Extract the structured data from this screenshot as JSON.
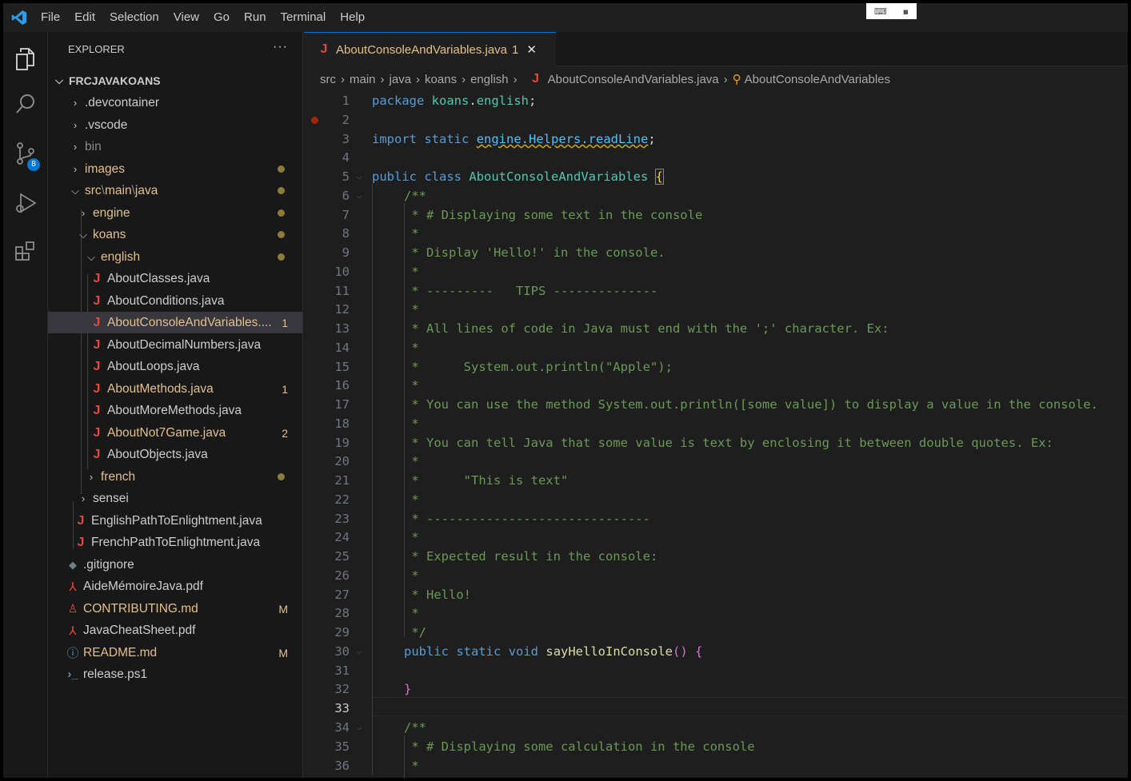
{
  "menu": [
    "File",
    "Edit",
    "Selection",
    "View",
    "Go",
    "Run",
    "Terminal",
    "Help"
  ],
  "activity": {
    "scm_badge": "8"
  },
  "sidebar": {
    "header": "EXPLORER",
    "more": "···",
    "root": "FRCJAVAKOANS",
    "items": [
      {
        "label": ".devcontainer"
      },
      {
        "label": ".vscode"
      },
      {
        "label": "bin"
      },
      {
        "label": "images"
      },
      {
        "label": "src",
        "sep": "\\",
        "part2": "main",
        "part3": "java"
      },
      {
        "label": "engine"
      },
      {
        "label": "koans"
      },
      {
        "label": "english"
      },
      {
        "label": "AboutClasses.java"
      },
      {
        "label": "AboutConditions.java"
      },
      {
        "label": "AboutConsoleAndVariables....",
        "badge": "1"
      },
      {
        "label": "AboutDecimalNumbers.java"
      },
      {
        "label": "AboutLoops.java"
      },
      {
        "label": "AboutMethods.java",
        "badge": "1"
      },
      {
        "label": "AboutMoreMethods.java"
      },
      {
        "label": "AboutNot7Game.java",
        "badge": "2"
      },
      {
        "label": "AboutObjects.java"
      },
      {
        "label": "french"
      },
      {
        "label": "sensei"
      },
      {
        "label": "EnglishPathToEnlightment.java"
      },
      {
        "label": "FrenchPathToEnlightment.java"
      },
      {
        "label": ".gitignore"
      },
      {
        "label": "AideMémoireJava.pdf"
      },
      {
        "label": "CONTRIBUTING.md",
        "badge": "M"
      },
      {
        "label": "JavaCheatSheet.pdf"
      },
      {
        "label": "README.md",
        "badge": "M"
      },
      {
        "label": "release.ps1"
      }
    ]
  },
  "tab": {
    "label": "AboutConsoleAndVariables.java",
    "badge": "1",
    "close": "✕"
  },
  "breadcrumbs": [
    "src",
    "main",
    "java",
    "koans",
    "english",
    "AboutConsoleAndVariables.java",
    "AboutConsoleAndVariables"
  ],
  "code": {
    "line_numbers": [
      "1",
      "2",
      "3",
      "4",
      "5",
      "6",
      "7",
      "8",
      "9",
      "10",
      "11",
      "12",
      "13",
      "14",
      "15",
      "16",
      "17",
      "18",
      "19",
      "20",
      "21",
      "22",
      "23",
      "24",
      "25",
      "26",
      "27",
      "28",
      "29",
      "30",
      "31",
      "32",
      "33",
      "34",
      "35",
      "36"
    ],
    "l1_kw": "package",
    "l1_pkg": "koans",
    "l1_dot": ".",
    "l1_pkg2": "english",
    "l1_semi": ";",
    "l3_kw1": "import",
    "l3_kw2": "static",
    "l3_ref": "engine.Helpers.readLine",
    "l3_semi": ";",
    "l5_kw1": "public",
    "l5_kw2": "class",
    "l5_name": "AboutConsoleAndVariables",
    "l5_brace": "{",
    "l6": "/**",
    "l7": " * # Displaying some text in the console",
    "l8": " *",
    "l9": " * Display 'Hello!' in the console.",
    "l10": " *",
    "l11": " * ---------   TIPS --------------",
    "l12": " *",
    "l13": " * All lines of code in Java must end with the ';' character. Ex:",
    "l14": " *",
    "l15": " *      System.out.println(\"Apple\");",
    "l16": " *",
    "l17": " * You can use the method System.out.println([some value]) to display a value in the console.",
    "l18": " *",
    "l19": " * You can tell Java that some value is text by enclosing it between double quotes. Ex:",
    "l20": " *",
    "l21": " *      \"This is text\"",
    "l22": " *",
    "l23": " * ------------------------------",
    "l24": " *",
    "l25": " * Expected result in the console:",
    "l26": " *",
    "l27": " * Hello!",
    "l28": " *",
    "l29": " */",
    "l30_kw1": "public",
    "l30_kw2": "static",
    "l30_kw3": "void",
    "l30_fn": "sayHelloInConsole",
    "l30_paren": "()",
    "l30_brace": "{",
    "l32": "}",
    "l34": "/**",
    "l35": " * # Displaying some calculation in the console",
    "l36": " *"
  }
}
